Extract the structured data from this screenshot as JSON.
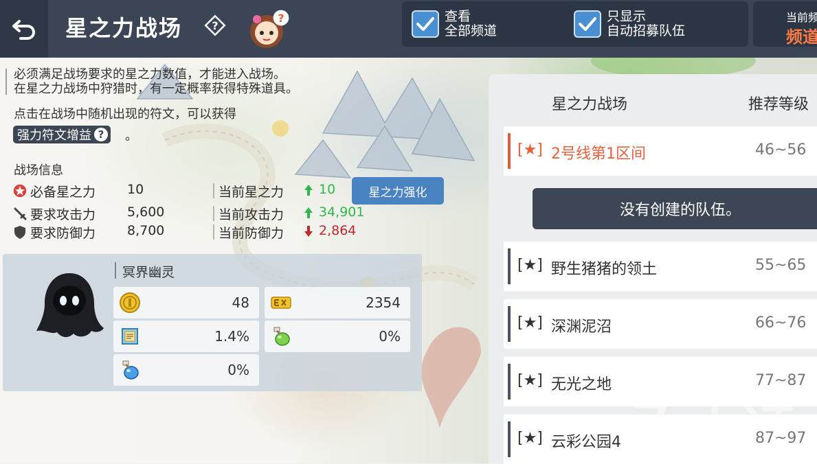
{
  "header": {
    "title": "星之力战场",
    "help_icon": "question-diamond-icon",
    "mascot_icon": "girl-mascot-icon",
    "view_all_channels": {
      "line1": "查看",
      "line2": "全部频道",
      "checked": true
    },
    "auto_recruit_only": {
      "line1": "只显示",
      "line2": "自动招募队伍",
      "checked": true
    },
    "current_channel": {
      "label": "当前频",
      "value": "频道"
    }
  },
  "description": {
    "line1": "必须满足战场要求的星之力数值，才能进入战场。",
    "line2": "在星之力战场中狩猎时，有一定概率获得特殊道具。",
    "line3": "点击在战场中随机出现的符文，可以获得",
    "rune_buff": "强力符文增益",
    "rune_help": "?",
    "period": "。"
  },
  "battle_info": {
    "header": "战场信息",
    "rows": [
      {
        "label": "必备星之力",
        "value": "10",
        "current_label": "当前星之力",
        "current_value": "10",
        "trend": "up"
      },
      {
        "label": "要求攻击力",
        "value": "5,600",
        "current_label": "当前攻击力",
        "current_value": "34,901",
        "trend": "up"
      },
      {
        "label": "要求防御力",
        "value": "8,700",
        "current_label": "当前防御力",
        "current_value": "2,864",
        "trend": "down"
      }
    ],
    "enhance_button": "星之力强化"
  },
  "monster": {
    "name": "冥界幽灵",
    "drops": [
      {
        "icon": "gold-coin-icon",
        "value": "48"
      },
      {
        "icon": "exp-icon",
        "value": "2354"
      },
      {
        "icon": "scroll-icon",
        "value": "1.4%"
      },
      {
        "icon": "green-potion-icon",
        "value": "0%"
      },
      {
        "icon": "blue-potion-icon",
        "value": "0%"
      }
    ]
  },
  "zones": {
    "col_name": "星之力战场",
    "col_level": "推荐等级",
    "no_team": "没有创建的队伍。",
    "list": [
      {
        "star": "[★]",
        "name": "2号线第1区间",
        "level": "46~56",
        "selected": true
      },
      {
        "star": "[★]",
        "name": "野生猪猪的领土",
        "level": "55~65",
        "selected": false
      },
      {
        "star": "[★]",
        "name": "深渊泥沼",
        "level": "66~76",
        "selected": false
      },
      {
        "star": "[★]",
        "name": "无光之地",
        "level": "77~87",
        "selected": false
      },
      {
        "star": "[★]",
        "name": "云彩公园4",
        "level": "87~97",
        "selected": false
      }
    ]
  },
  "colors": {
    "header_bg": "#3b4555",
    "accent_orange": "#e8603c",
    "button_blue": "#4a83c2",
    "up_green": "#2fb84a",
    "down_red": "#c0282c"
  }
}
